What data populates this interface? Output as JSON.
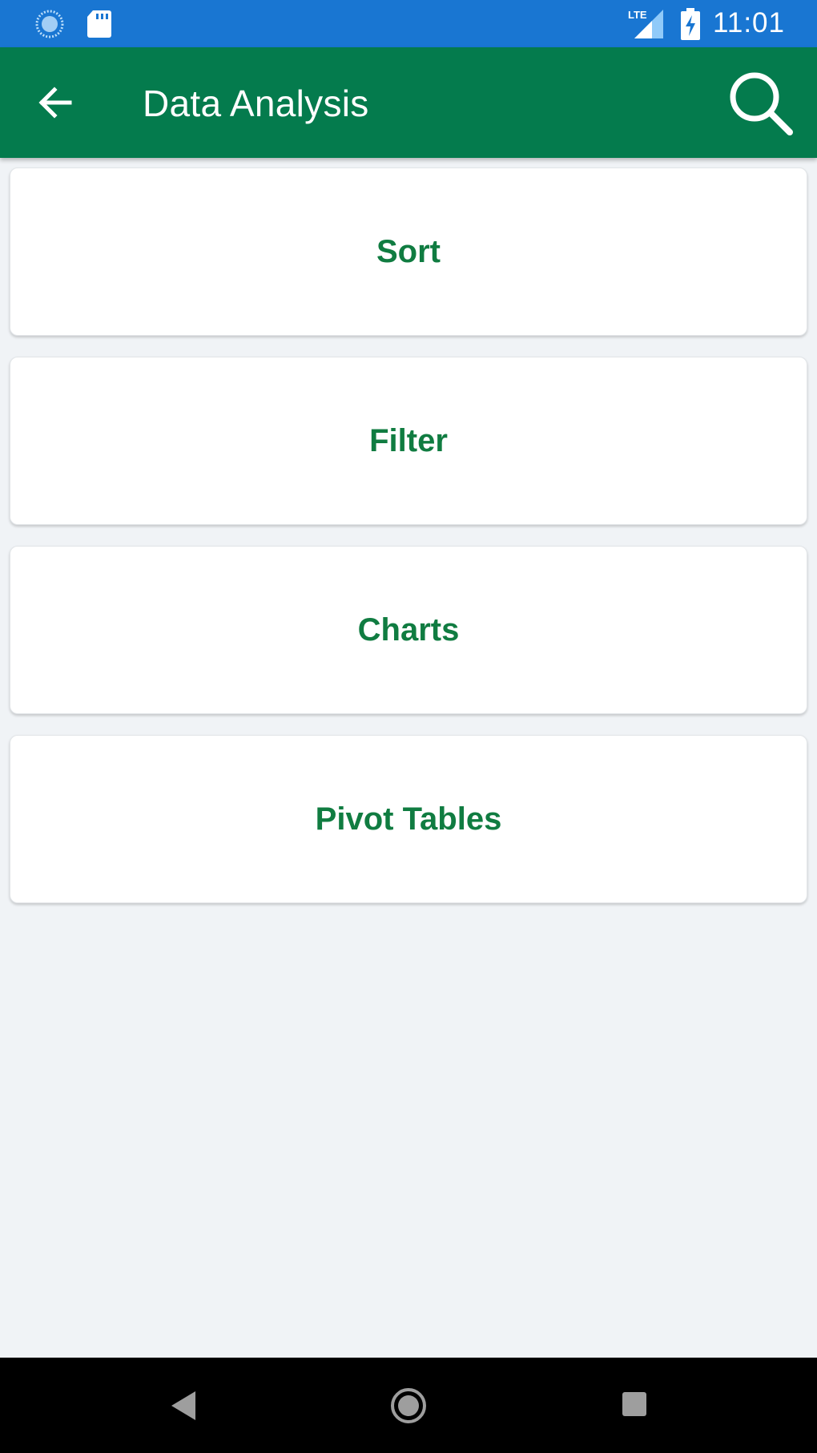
{
  "status_bar": {
    "time": "11:01",
    "network_label": "LTE",
    "icons": [
      "loading-icon",
      "sd-card-icon",
      "lte-signal-icon",
      "battery-charging-icon"
    ],
    "color": "#1976d2"
  },
  "app_bar": {
    "title": "Data Analysis",
    "back_icon": "arrow-back-icon",
    "search_icon": "search-icon",
    "color": "#047b4d"
  },
  "menu": {
    "items": [
      {
        "label": "Sort"
      },
      {
        "label": "Filter"
      },
      {
        "label": "Charts"
      },
      {
        "label": "Pivot Tables"
      }
    ],
    "label_color": "#107c41"
  },
  "nav_bar": {
    "icons": [
      "nav-back-icon",
      "nav-home-icon",
      "nav-recents-icon"
    ]
  }
}
